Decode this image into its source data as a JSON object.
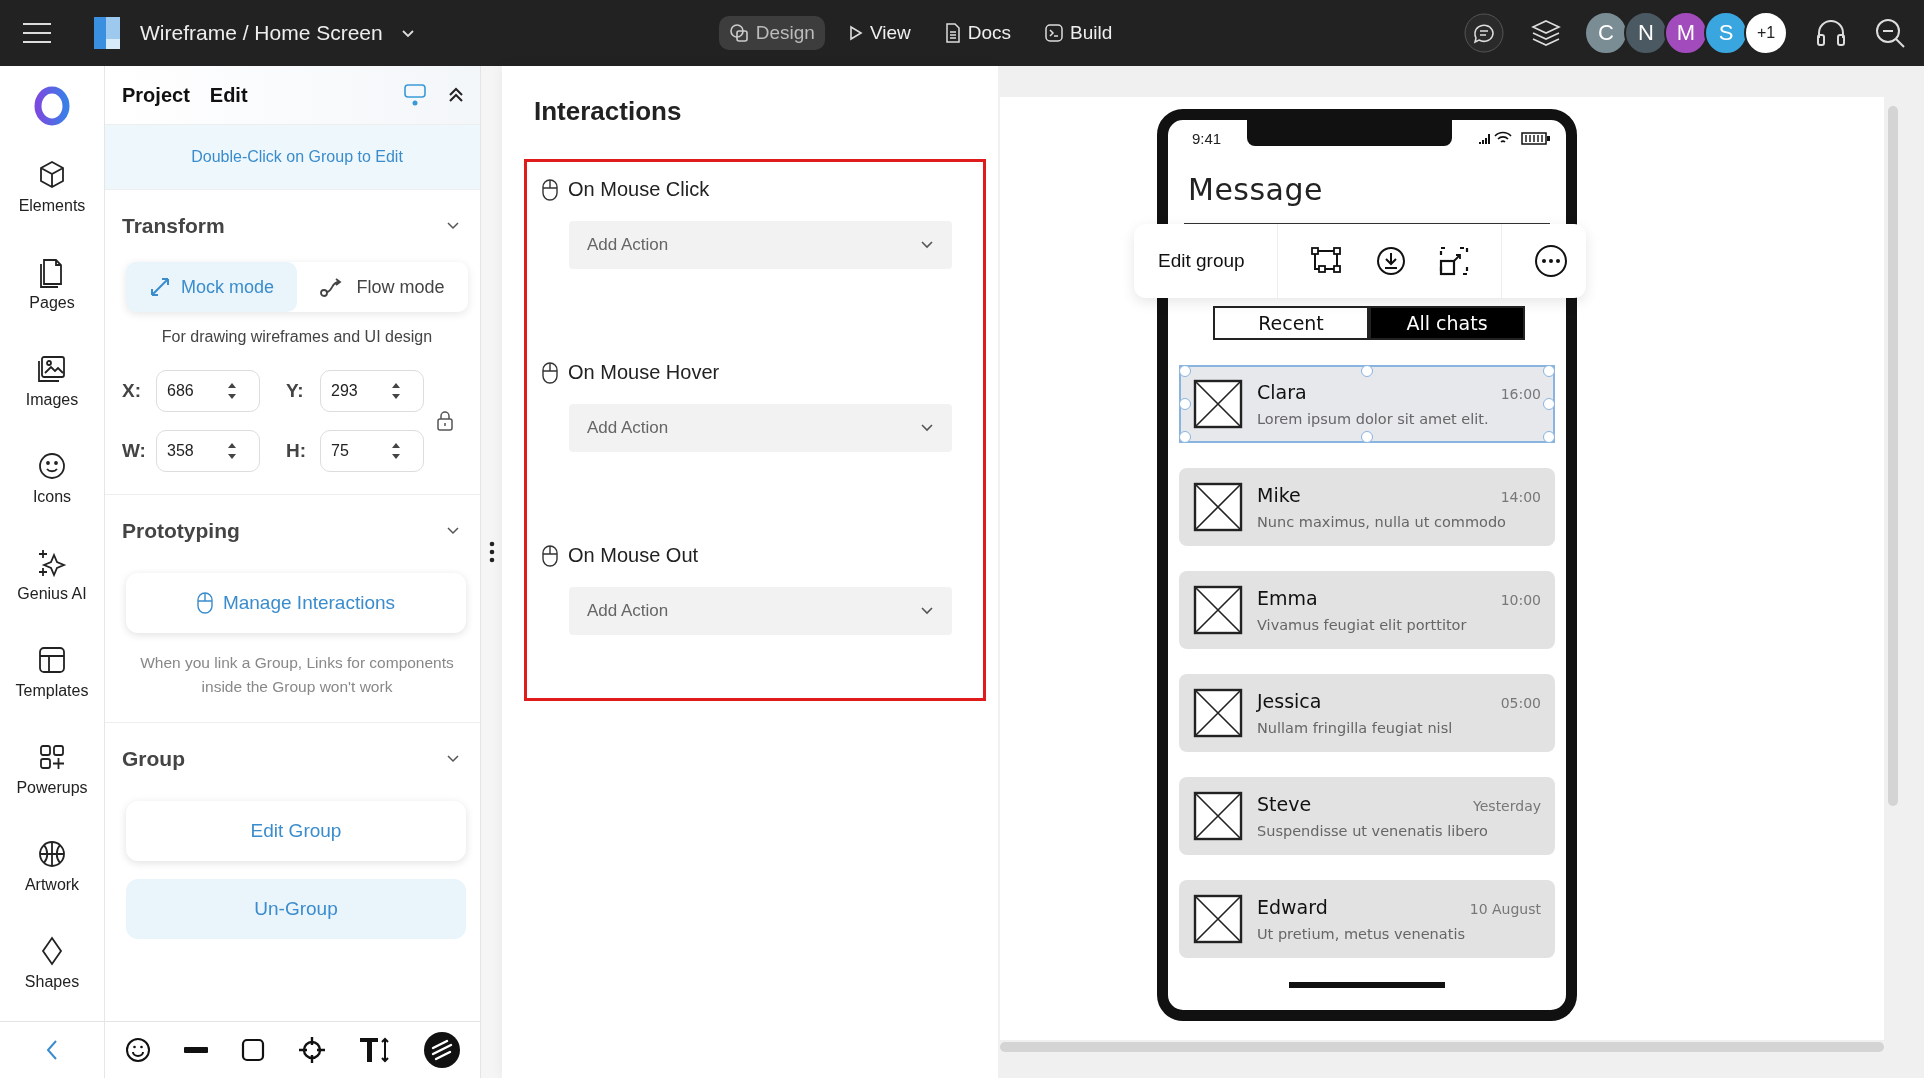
{
  "topbar": {
    "title": "Wireframe / Home Screen",
    "nav": [
      {
        "label": "Design",
        "selected": true
      },
      {
        "label": "View",
        "selected": false
      },
      {
        "label": "Docs",
        "selected": false
      },
      {
        "label": "Build",
        "selected": false
      }
    ],
    "avatars": [
      {
        "label": "C",
        "color": "#7b8d94"
      },
      {
        "label": "N",
        "color": "#4a5962"
      },
      {
        "label": "M",
        "color": "#a24bbd"
      },
      {
        "label": "S",
        "color": "#3aa6df"
      },
      {
        "label": "+1",
        "color": "#ffffff"
      }
    ]
  },
  "rail": {
    "items": [
      {
        "label": "Elements"
      },
      {
        "label": "Pages"
      },
      {
        "label": "Images"
      },
      {
        "label": "Icons"
      },
      {
        "label": "Genius AI"
      },
      {
        "label": "Templates"
      },
      {
        "label": "Powerups"
      },
      {
        "label": "Artwork"
      },
      {
        "label": "Shapes"
      }
    ]
  },
  "panel": {
    "tabs": [
      "Project",
      "Edit"
    ],
    "hint": "Double-Click on Group to Edit",
    "transform": {
      "title": "Transform",
      "modes": [
        {
          "label": "Mock mode",
          "selected": true
        },
        {
          "label": "Flow mode",
          "selected": false
        }
      ],
      "note": "For drawing wireframes and UI design",
      "fields": [
        {
          "label": "X:",
          "value": "686"
        },
        {
          "label": "Y:",
          "value": "293"
        },
        {
          "label": "W:",
          "value": "358"
        },
        {
          "label": "H:",
          "value": "75"
        }
      ]
    },
    "prototyping": {
      "title": "Prototyping",
      "button": "Manage Interactions",
      "note": "When you link a Group, Links for components inside the Group won't work"
    },
    "group": {
      "title": "Group",
      "buttons": [
        {
          "label": "Edit Group",
          "kind": "plain"
        },
        {
          "label": "Un-Group",
          "kind": "tinted"
        }
      ]
    }
  },
  "interactions": {
    "title": "Interactions",
    "events": [
      {
        "label": "On Mouse Click",
        "value": "Add Action"
      },
      {
        "label": "On Mouse Hover",
        "value": "Add Action"
      },
      {
        "label": "On Mouse Out",
        "value": "Add Action"
      }
    ]
  },
  "canvas": {
    "popover": {
      "label": "Edit group"
    },
    "phone": {
      "time": "9:41",
      "title": "Message",
      "tabs": [
        {
          "label": "Recent",
          "selected": false
        },
        {
          "label": "All chats",
          "selected": true
        }
      ],
      "chats": [
        {
          "name": "Clara",
          "time": "16:00",
          "preview": "Lorem ipsum dolor sit amet elit.",
          "selected": true
        },
        {
          "name": "Mike",
          "time": "14:00",
          "preview": "Nunc maximus, nulla ut commodo",
          "selected": false
        },
        {
          "name": "Emma",
          "time": "10:00",
          "preview": "Vivamus feugiat elit porttitor",
          "selected": false
        },
        {
          "name": "Jessica",
          "time": "05:00",
          "preview": "Nullam fringilla feugiat nisl",
          "selected": false
        },
        {
          "name": "Steve",
          "time": "Yesterday",
          "preview": "Suspendisse ut venenatis libero",
          "selected": false
        },
        {
          "name": "Edward",
          "time": "10 August",
          "preview": "Ut pretium, metus venenatis",
          "selected": false
        }
      ]
    }
  }
}
